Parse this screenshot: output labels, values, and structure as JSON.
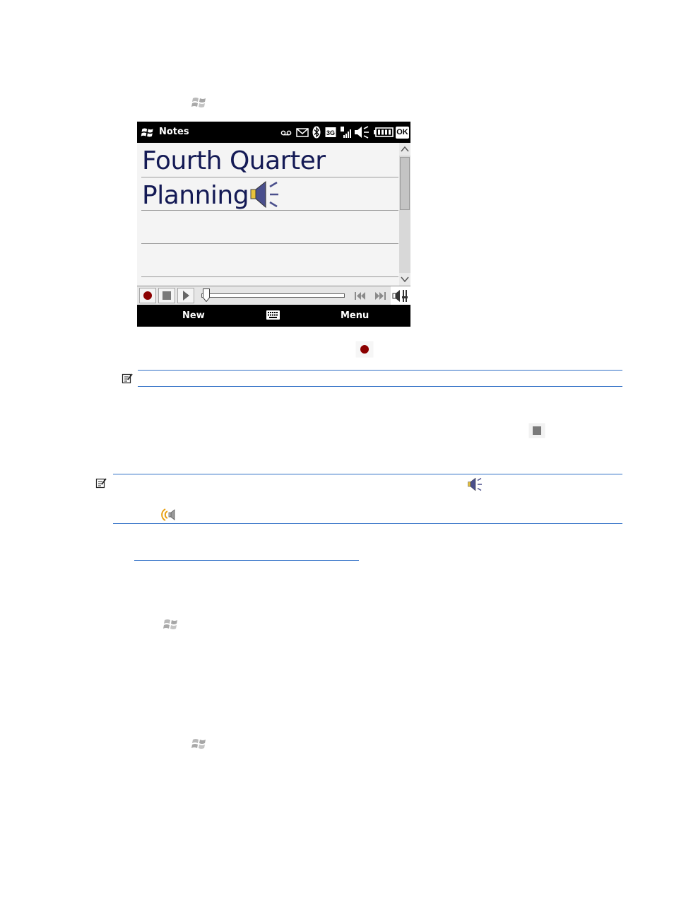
{
  "phone": {
    "app_title": "Notes",
    "ok_label": "OK",
    "note_lines": [
      "Fourth Quarter",
      "Planning"
    ],
    "softkeys": {
      "left": "New",
      "right": "Menu"
    },
    "status_icons": [
      "voicemail-icon",
      "envelope-icon",
      "bluetooth-icon",
      "3g-icon",
      "signal-icon",
      "speaker-muted-icon",
      "battery-icon"
    ],
    "toolbar_icons": [
      "record-icon",
      "stop-icon",
      "play-icon",
      "skip-back-icon",
      "skip-forward-icon",
      "volume-icon"
    ]
  },
  "doc_icons": [
    "windows-start-icon",
    "record-button-icon",
    "note-icon",
    "stop-button-icon",
    "voice-note-icon",
    "speaker-playing-icon"
  ],
  "colors": {
    "rule": "#2f6fc6",
    "record": "#8b0000",
    "note_text": "#141a55"
  }
}
